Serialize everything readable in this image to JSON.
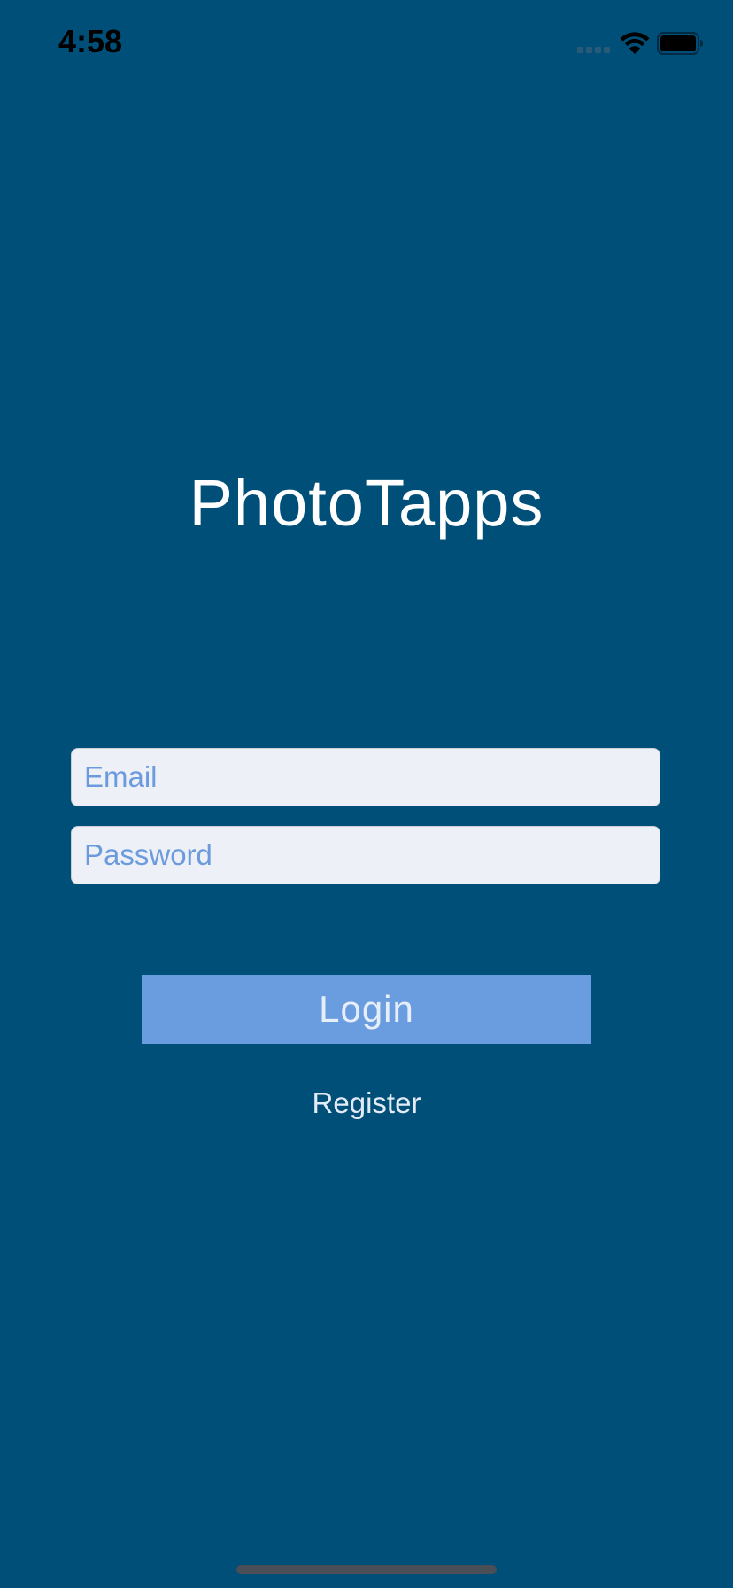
{
  "status_bar": {
    "time": "4:58",
    "icons": [
      "signal-icon",
      "wifi-icon",
      "battery-icon"
    ]
  },
  "app": {
    "title": "PhotoTapps"
  },
  "form": {
    "email_placeholder": "Email",
    "email_value": "",
    "password_placeholder": "Password",
    "password_value": "",
    "login_label": "Login",
    "register_label": "Register"
  },
  "colors": {
    "background": "#004F79",
    "field_background": "#EEF0F8",
    "placeholder": "#6C9BDD",
    "button": "#6A9DDF",
    "button_text": "#E6EEF9",
    "title_text": "#FFFFFF"
  }
}
